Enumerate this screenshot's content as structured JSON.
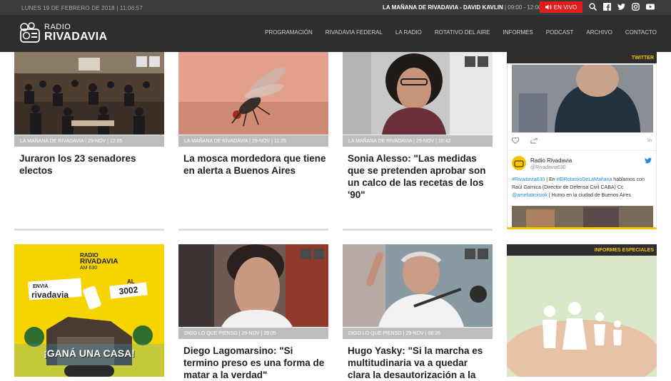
{
  "topbar": {
    "date": "LUNES 19 DE FEBRERO DE 2018",
    "time": "11:06:57",
    "program": "LA MAÑANA DE RIVADAVIA",
    "host": "DAVID KAVLIN",
    "hours": "09:00 - 12:00",
    "live": "EN VIVO"
  },
  "logo": {
    "line1": "RADIO",
    "line2": "RIVADAVIA"
  },
  "menu": [
    "PROGRAMACIÓN",
    "RIVADAVIA FEDERAL",
    "LA RADIO",
    "ROTATIVO DEL AIRE",
    "INFORMES",
    "PODCAST",
    "ARCHIVO",
    "CONTACTO"
  ],
  "cards": [
    {
      "cat": "LA MAÑANA DE RIVADAVIA | 29-NOV | 12:05",
      "title": "Juraron los 23 senadores electos"
    },
    {
      "cat": "LA MAÑANA DE RIVADAVIA | 29-NOV | 11:25",
      "title": "La mosca mordedora que tiene en alerta a Buenos Aires"
    },
    {
      "cat": "LA MAÑANA DE RIVADAVIA | 29-NOV | 10:42",
      "title": "Sonia Alesso: \"Las medidas que se pretenden aprobar son un calco de las recetas de los '90\""
    },
    {
      "cat": "DIGO LO QUE PIENSO | 29-NOV | 09:05",
      "title": "Diego Lagomarsino: \"Si termino preso es una forma de matar a la verdad\""
    },
    {
      "cat": "DIGO LO QUE PIENSO | 29-NOV | 08:26",
      "title": "Hugo Yasky: \"Si la marcha es multitudinaria va a quedar clara la desautorización a la"
    }
  ],
  "twitter": {
    "head": "TWITTER",
    "name": "Radio Rivadavia",
    "handle": "@Rivadavia630",
    "age": "3h",
    "t1": "#Rivadavia630",
    "t2": " | En ",
    "t3": "#ElRotativoDeLaMañana",
    "t4": " hablamos con Raúl Garnica (Director de Defensa Civil CABA) Cc ",
    "t5": "@ameliatroisiok",
    "t6": " | Humo en la ciudad de Buenos Aires"
  },
  "informes": {
    "head": "INFORMES ESPECIALES"
  },
  "promo": {
    "radio": "RADIO",
    "rivadavia": "RIVADAVIA",
    "am": "AM 630",
    "envia": "ENVIÁ",
    "word": "rivadavia",
    "al": "AL",
    "num": "3002",
    "gana": "¡GANÁ UNA CASA!"
  },
  "colors": {
    "accent": "#f5c400",
    "live": "#e21b1b",
    "nav": "#2e2e30",
    "link": "#1d8ed9"
  }
}
